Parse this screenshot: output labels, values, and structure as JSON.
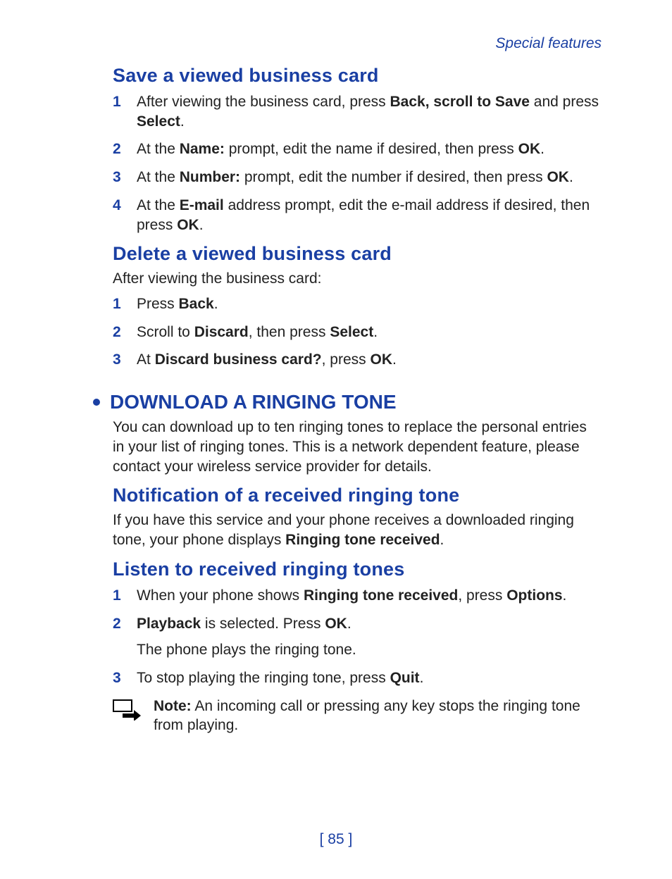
{
  "header": {
    "section_label": "Special features"
  },
  "sections": {
    "save_card": {
      "heading": "Save a viewed business card",
      "steps": [
        {
          "num": "1",
          "parts": [
            {
              "t": "After viewing the business card, press ",
              "b": false
            },
            {
              "t": "Back, scroll to Save",
              "b": true
            },
            {
              "t": " and press ",
              "b": false
            },
            {
              "t": "Select",
              "b": true
            },
            {
              "t": ".",
              "b": false
            }
          ]
        },
        {
          "num": "2",
          "parts": [
            {
              "t": "At the ",
              "b": false
            },
            {
              "t": "Name:",
              "b": true
            },
            {
              "t": " prompt, edit the name if desired, then press ",
              "b": false
            },
            {
              "t": "OK",
              "b": true
            },
            {
              "t": ".",
              "b": false
            }
          ]
        },
        {
          "num": "3",
          "parts": [
            {
              "t": "At the ",
              "b": false
            },
            {
              "t": "Number:",
              "b": true
            },
            {
              "t": " prompt, edit the number if desired, then press ",
              "b": false
            },
            {
              "t": "OK",
              "b": true
            },
            {
              "t": ".",
              "b": false
            }
          ]
        },
        {
          "num": "4",
          "parts": [
            {
              "t": "At the ",
              "b": false
            },
            {
              "t": "E-mail",
              "b": true
            },
            {
              "t": " address prompt, edit the e-mail address if desired, then press ",
              "b": false
            },
            {
              "t": "OK",
              "b": true
            },
            {
              "t": ".",
              "b": false
            }
          ]
        }
      ]
    },
    "delete_card": {
      "heading": "Delete a viewed business card",
      "intro": "After viewing the business card:",
      "steps": [
        {
          "num": "1",
          "parts": [
            {
              "t": "Press ",
              "b": false
            },
            {
              "t": "Back",
              "b": true
            },
            {
              "t": ".",
              "b": false
            }
          ]
        },
        {
          "num": "2",
          "parts": [
            {
              "t": "Scroll to ",
              "b": false
            },
            {
              "t": "Discard",
              "b": true
            },
            {
              "t": ", then press ",
              "b": false
            },
            {
              "t": "Select",
              "b": true
            },
            {
              "t": ".",
              "b": false
            }
          ]
        },
        {
          "num": "3",
          "parts": [
            {
              "t": "At ",
              "b": false
            },
            {
              "t": "Discard business card?",
              "b": true
            },
            {
              "t": ", press ",
              "b": false
            },
            {
              "t": "OK",
              "b": true
            },
            {
              "t": ".",
              "b": false
            }
          ]
        }
      ]
    },
    "download_tone": {
      "heading": "DOWNLOAD A RINGING TONE",
      "intro": "You can download up to ten ringing tones to replace the personal entries in your list of ringing tones. This is a network dependent feature, please contact your wireless service provider for details."
    },
    "notification": {
      "heading": "Notification of a received ringing tone",
      "intro_parts": [
        {
          "t": "If you have this service and your phone receives a downloaded ringing tone, your phone displays ",
          "b": false
        },
        {
          "t": "Ringing tone received",
          "b": true
        },
        {
          "t": ".",
          "b": false
        }
      ]
    },
    "listen": {
      "heading": "Listen to received ringing tones",
      "steps": [
        {
          "num": "1",
          "parts": [
            {
              "t": "When your phone shows ",
              "b": false
            },
            {
              "t": "Ringing tone received",
              "b": true
            },
            {
              "t": ", press ",
              "b": false
            },
            {
              "t": "Options",
              "b": true
            },
            {
              "t": ".",
              "b": false
            }
          ]
        },
        {
          "num": "2",
          "parts": [
            {
              "t": "Playback",
              "b": true
            },
            {
              "t": " is selected. Press ",
              "b": false
            },
            {
              "t": "OK",
              "b": true
            },
            {
              "t": ".",
              "b": false
            }
          ],
          "sub": "The phone plays the ringing tone."
        },
        {
          "num": "3",
          "parts": [
            {
              "t": "To stop playing the ringing tone, press ",
              "b": false
            },
            {
              "t": "Quit",
              "b": true
            },
            {
              "t": ".",
              "b": false
            }
          ]
        }
      ],
      "note_parts": [
        {
          "t": "Note:",
          "b": true
        },
        {
          "t": "  An incoming call or pressing any key stops the ringing tone from playing.",
          "b": false
        }
      ]
    }
  },
  "footer": {
    "page_number": "[ 85 ]"
  }
}
